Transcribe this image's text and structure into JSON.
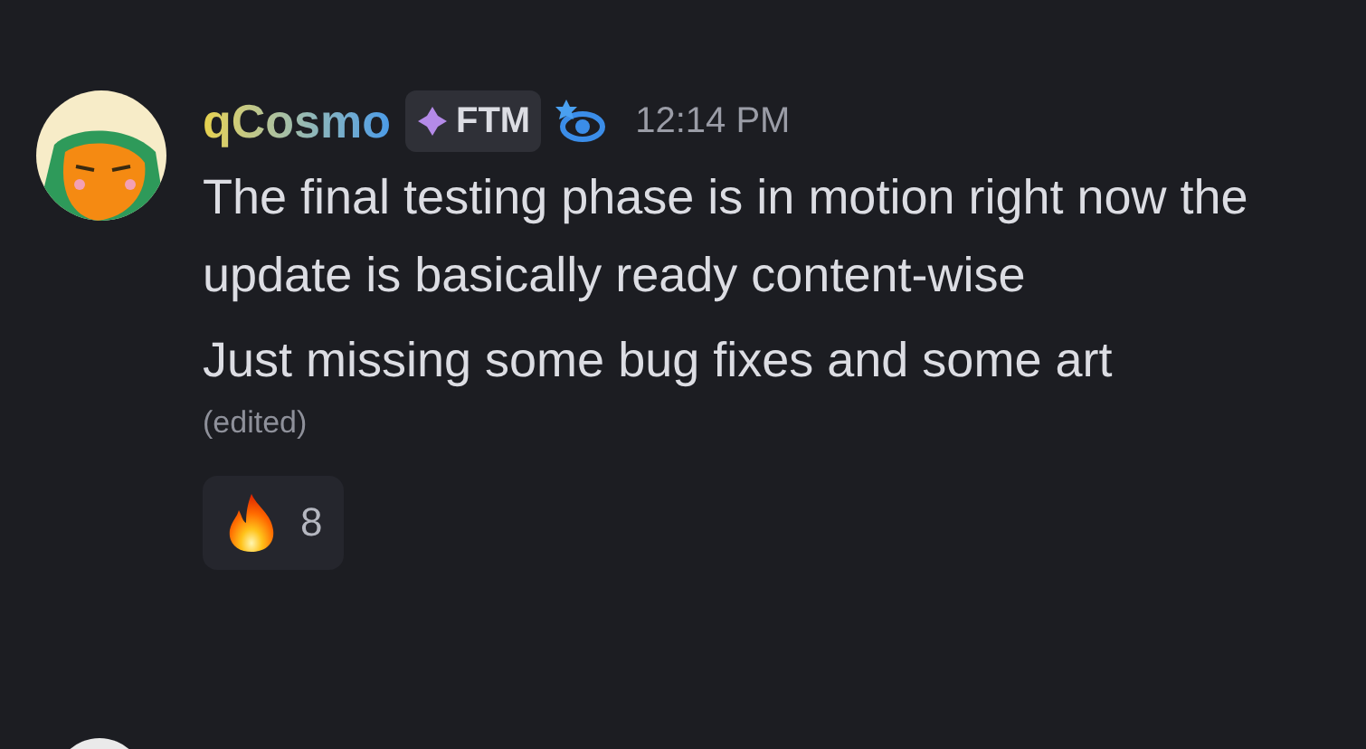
{
  "message": {
    "author": "qCosmo",
    "tag": "FTM",
    "time": "12:14 PM",
    "paragraphs": [
      "The final testing phase is in motion right now the update is basically ready content-wise",
      "Just missing some bug fixes and some art"
    ],
    "edited": "(edited)",
    "reactions": [
      {
        "kind": "fire",
        "count": "8",
        "selected": false
      }
    ]
  }
}
